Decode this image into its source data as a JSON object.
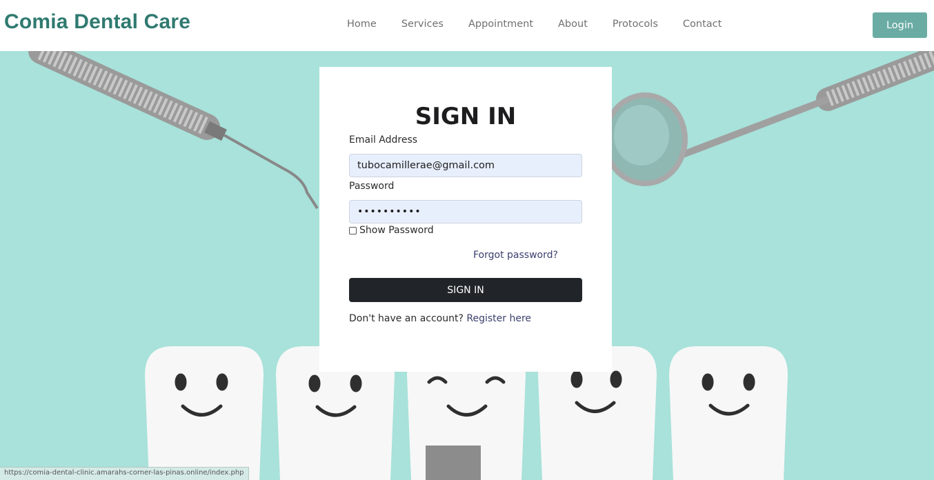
{
  "header": {
    "brand": "Comia Dental Care",
    "nav": [
      "Home",
      "Services",
      "Appointment",
      "About",
      "Protocols",
      "Contact"
    ],
    "login_label": "Login"
  },
  "form": {
    "title": "SIGN IN",
    "email_label": "Email Address",
    "email_value": "tubocamillerae@gmail.com",
    "password_label": "Password",
    "password_value": "••••••••••",
    "show_password_label": "Show Password",
    "forgot_label": "Forgot password?",
    "submit_label": "SIGN IN",
    "register_prompt": "Don't have an account?",
    "register_link": "Register here"
  },
  "status_url": "https://comia-dental-clinic.amarahs-corner-las-pinas.online/index.php",
  "colors": {
    "brand": "#2f7a70",
    "login_button": "#6aaca4",
    "hero_bg": "#a8e2da",
    "submit_button": "#212529",
    "link": "#3a3f6c"
  }
}
